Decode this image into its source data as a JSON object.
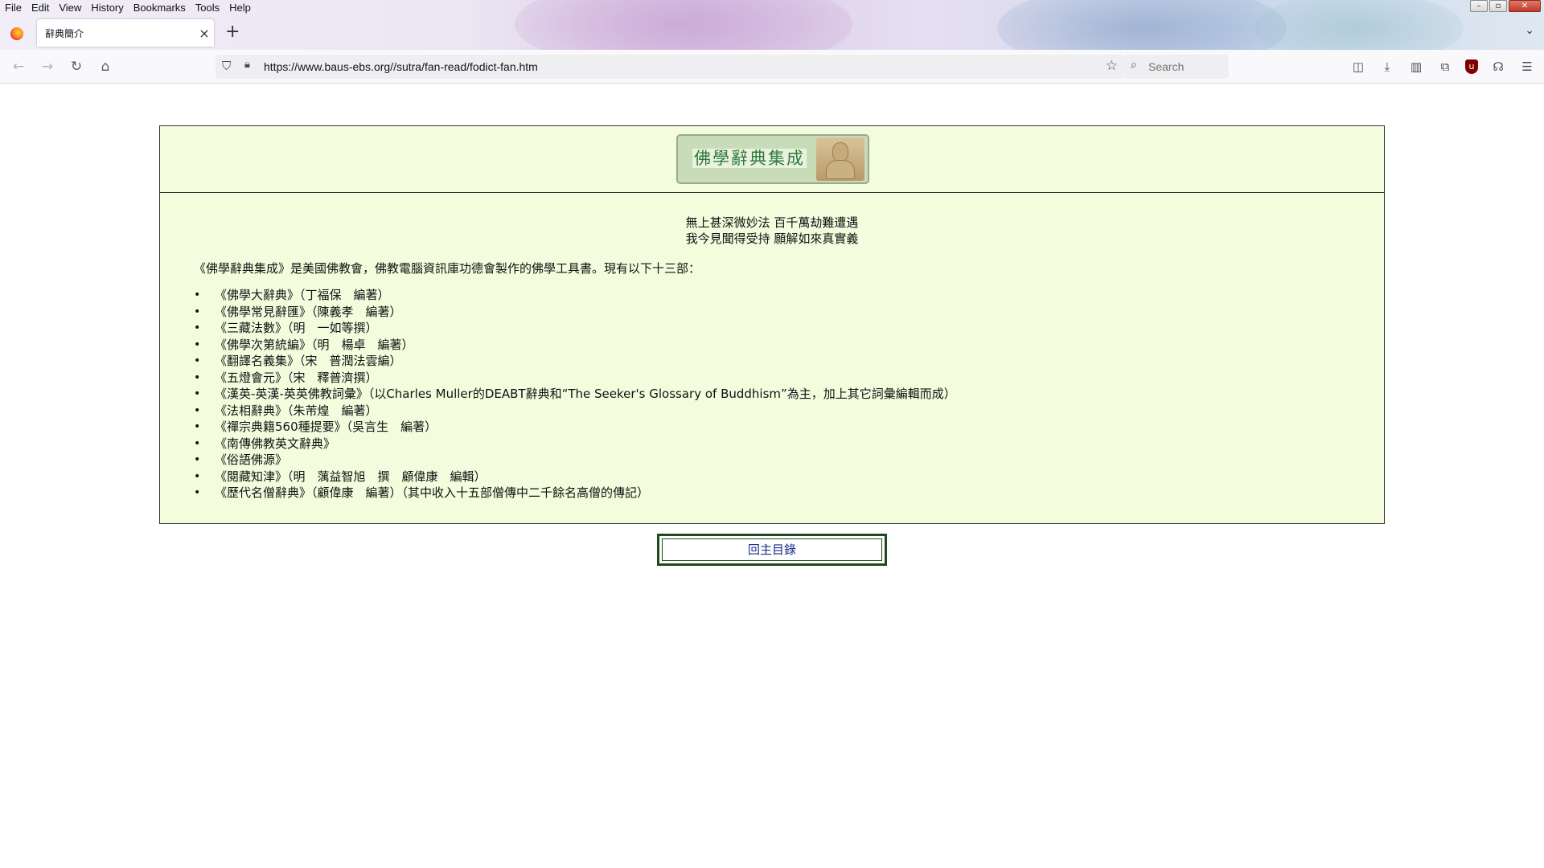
{
  "browser": {
    "menu": [
      "File",
      "Edit",
      "View",
      "History",
      "Bookmarks",
      "Tools",
      "Help"
    ],
    "tab_title": "辭典簡介",
    "url": "https://www.baus-ebs.org//sutra/fan-read/fodict-fan.htm",
    "search_placeholder": "Search",
    "new_tab_symbol": "+",
    "tab_close_symbol": "×"
  },
  "page": {
    "logo_text": "佛學辭典集成",
    "verse_line1": "無上甚深微妙法 百千萬劫難遭遇",
    "verse_line2": "我今見聞得受持 願解如來真實義",
    "intro": "《佛學辭典集成》是美國佛教會，佛教電腦資訊庫功德會製作的佛學工具書。現有以下十三部：",
    "books": [
      "《佛學大辭典》（丁福保　編著）",
      "《佛學常見辭匯》（陳義孝　編著）",
      "《三藏法數》（明　一如等撰）",
      "《佛學次第統編》（明　楊卓　編著）",
      "《翻譯名義集》（宋　普潤法雲編）",
      "《五燈會元》（宋　釋普濟撰）",
      "《漢英-英漢-英英佛教詞彙》（以Charles Muller的DEABT辭典和“The Seeker's Glossary of Buddhism”為主，加上其它詞彙編輯而成）",
      "《法相辭典》（朱芾煌　編著）",
      "《禪宗典籍560種提要》（吳言生　編著）",
      "《南傳佛教英文辭典》",
      "《俗語佛源》",
      "《閱藏知津》（明　蕅益智旭　撰　顧偉康　編輯）",
      "《歷代名僧辭典》（顧偉康　編著）（其中收入十五部僧傳中二千餘名高僧的傳記）"
    ],
    "back_button": "回主目錄"
  },
  "colors": {
    "panel_bg": "#f3fdde",
    "logo_text": "#2f7a3c",
    "button_text": "#1a2f8a",
    "button_border": "#1f4a1f"
  }
}
